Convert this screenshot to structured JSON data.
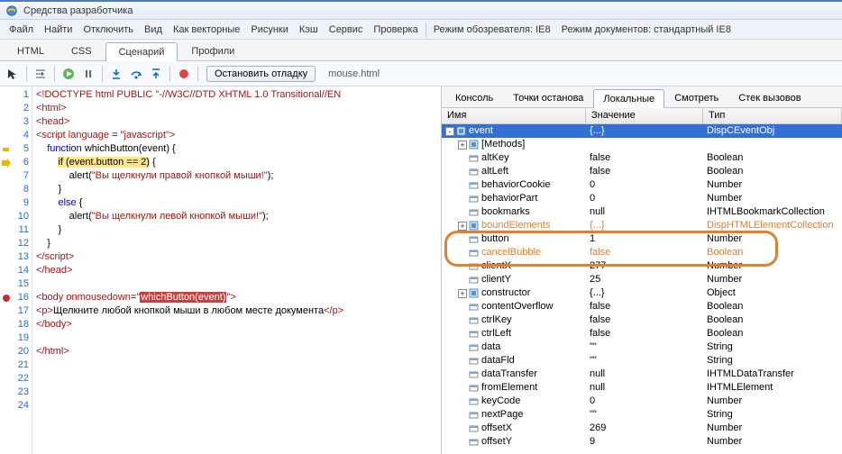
{
  "window": {
    "title": "Средства разработчика"
  },
  "menu": {
    "file": "Файл",
    "find": "Найти",
    "disable": "Отключить",
    "view": "Вид",
    "vectors": "Как векторные",
    "images": "Рисунки",
    "cache": "Кэш",
    "service": "Сервис",
    "check": "Проверка",
    "browserMode": "Режим обозревателя: IE8",
    "docMode": "Режим документов: стандартный IE8"
  },
  "tabs": {
    "html": "HTML",
    "css": "CSS",
    "script": "Сценарий",
    "profiles": "Профили"
  },
  "toolbar": {
    "stop": "Остановить отладку",
    "file": "mouse.html"
  },
  "rightTabs": {
    "console": "Консоль",
    "breakpoints": "Точки останова",
    "locals": "Локальные",
    "watch": "Смотреть",
    "callstack": "Стек вызовов"
  },
  "varHeaders": {
    "name": "Имя",
    "value": "Значение",
    "type": "Тип"
  },
  "code": [
    {
      "n": 1,
      "html": "<span class='k-tag'>&lt;!DOCTYPE html PUBLIC </span><span class='k-str'>\"-//W3C//DTD XHTML 1.0 Transitional//EN</span>"
    },
    {
      "n": 2,
      "html": "<span class='k-tag'>&lt;html&gt;</span>"
    },
    {
      "n": 3,
      "html": "<span class='k-tag'>&lt;head&gt;</span>"
    },
    {
      "n": 4,
      "html": "<span class='k-tag'>&lt;script </span><span class='k-attr'>language</span> = <span class='k-str'>\"javascript\"</span><span class='k-tag'>&gt;</span>"
    },
    {
      "n": 5,
      "html": "    <span class='k-kw'>function</span> whichButton(event) {",
      "ind": "curr"
    },
    {
      "n": 6,
      "html": "        <span class='hl-yellow'>if (event.button == 2)</span> {",
      "ind": "arrow"
    },
    {
      "n": 7,
      "html": "            alert(<span class='k-str'>\"Вы щелкнули правой кнопкой мыши!\"</span>);"
    },
    {
      "n": 8,
      "html": "        }"
    },
    {
      "n": 9,
      "html": "        <span class='k-kw'>else</span> {"
    },
    {
      "n": 10,
      "html": "            alert(<span class='k-str'>\"Вы щелкнули левой кнопкой мыши!\"</span>);"
    },
    {
      "n": 11,
      "html": "        }"
    },
    {
      "n": 12,
      "html": "    }"
    },
    {
      "n": 13,
      "html": "<span class='k-tag'>&lt;/script&gt;</span>"
    },
    {
      "n": 14,
      "html": "<span class='k-tag'>&lt;/head&gt;</span>"
    },
    {
      "n": 15,
      "html": ""
    },
    {
      "n": 16,
      "html": "<span class='k-tag'>&lt;body </span><span class='k-attr'>onmousedown</span>=<span class='k-str'>\"</span><span class='hl-red'>whichButton(event)</span><span class='k-str'>\"</span><span class='k-tag'>&gt;</span>",
      "ind": "bp"
    },
    {
      "n": 17,
      "html": "<span class='k-tag'>&lt;p&gt;</span>Щелкните любой кнопкой мыши в любом месте документа<span class='k-tag'>&lt;/p&gt;</span>"
    },
    {
      "n": 18,
      "html": "<span class='k-tag'>&lt;/body&gt;</span>"
    },
    {
      "n": 19,
      "html": ""
    },
    {
      "n": 20,
      "html": "<span class='k-tag'>&lt;/html&gt;</span>"
    },
    {
      "n": 21,
      "html": ""
    },
    {
      "n": 22,
      "html": ""
    },
    {
      "n": 23,
      "html": ""
    },
    {
      "n": 24,
      "html": ""
    }
  ],
  "vars": [
    {
      "depth": 0,
      "toggle": "-",
      "sel": true,
      "icon": "obj",
      "name": "event",
      "val": "{...}",
      "type": "DispCEventObj"
    },
    {
      "depth": 1,
      "toggle": "+",
      "icon": "obj",
      "name": "[Methods]",
      "val": "",
      "type": ""
    },
    {
      "depth": 1,
      "icon": "prop",
      "name": "altKey",
      "val": "false",
      "type": "Boolean"
    },
    {
      "depth": 1,
      "icon": "prop",
      "name": "altLeft",
      "val": "false",
      "type": "Boolean"
    },
    {
      "depth": 1,
      "icon": "prop",
      "name": "behaviorCookie",
      "val": "0",
      "type": "Number"
    },
    {
      "depth": 1,
      "icon": "prop",
      "name": "behaviorPart",
      "val": "0",
      "type": "Number"
    },
    {
      "depth": 1,
      "icon": "prop",
      "name": "bookmarks",
      "val": "null",
      "type": "IHTMLBookmarkCollection"
    },
    {
      "depth": 1,
      "toggle": "+",
      "icon": "obj",
      "name": "boundElements",
      "val": "{...}",
      "type": "DispHTMLElementCollection",
      "orange": true
    },
    {
      "depth": 1,
      "icon": "prop",
      "name": "button",
      "val": "1",
      "type": "Number"
    },
    {
      "depth": 1,
      "icon": "prop",
      "name": "cancelBubble",
      "val": "false",
      "type": "Boolean",
      "orange": true
    },
    {
      "depth": 1,
      "icon": "prop",
      "name": "clientX",
      "val": "277",
      "type": "Number"
    },
    {
      "depth": 1,
      "icon": "prop",
      "name": "clientY",
      "val": "25",
      "type": "Number"
    },
    {
      "depth": 1,
      "toggle": "+",
      "icon": "obj",
      "name": "constructor",
      "val": "{...}",
      "type": "Object"
    },
    {
      "depth": 1,
      "icon": "prop",
      "name": "contentOverflow",
      "val": "false",
      "type": "Boolean"
    },
    {
      "depth": 1,
      "icon": "prop",
      "name": "ctrlKey",
      "val": "false",
      "type": "Boolean"
    },
    {
      "depth": 1,
      "icon": "prop",
      "name": "ctrlLeft",
      "val": "false",
      "type": "Boolean"
    },
    {
      "depth": 1,
      "icon": "prop",
      "name": "data",
      "val": "\"\"",
      "type": "String"
    },
    {
      "depth": 1,
      "icon": "prop",
      "name": "dataFld",
      "val": "\"\"",
      "type": "String"
    },
    {
      "depth": 1,
      "icon": "prop",
      "name": "dataTransfer",
      "val": "null",
      "type": "IHTMLDataTransfer"
    },
    {
      "depth": 1,
      "icon": "prop",
      "name": "fromElement",
      "val": "null",
      "type": "IHTMLElement"
    },
    {
      "depth": 1,
      "icon": "prop",
      "name": "keyCode",
      "val": "0",
      "type": "Number"
    },
    {
      "depth": 1,
      "icon": "prop",
      "name": "nextPage",
      "val": "\"\"",
      "type": "String"
    },
    {
      "depth": 1,
      "icon": "prop",
      "name": "offsetX",
      "val": "269",
      "type": "Number"
    },
    {
      "depth": 1,
      "icon": "prop",
      "name": "offsetY",
      "val": "9",
      "type": "Number"
    }
  ]
}
